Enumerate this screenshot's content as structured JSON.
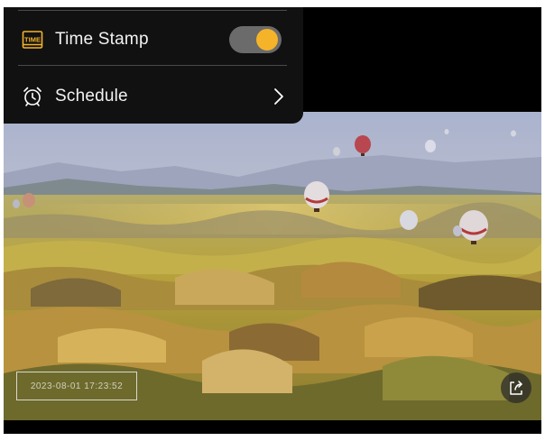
{
  "settings_menu": {
    "time_stamp": {
      "icon": "time-stamp-icon",
      "icon_text": "TIME",
      "label": "Time Stamp",
      "toggle_on": true,
      "accent_color": "#f5b32a"
    },
    "schedule": {
      "icon": "alarm-clock-icon",
      "label": "Schedule",
      "trailing_icon": "chevron-right-icon"
    }
  },
  "video": {
    "timestamp_overlay": "2023-08-01  17:23:52",
    "share_icon": "export-icon"
  }
}
